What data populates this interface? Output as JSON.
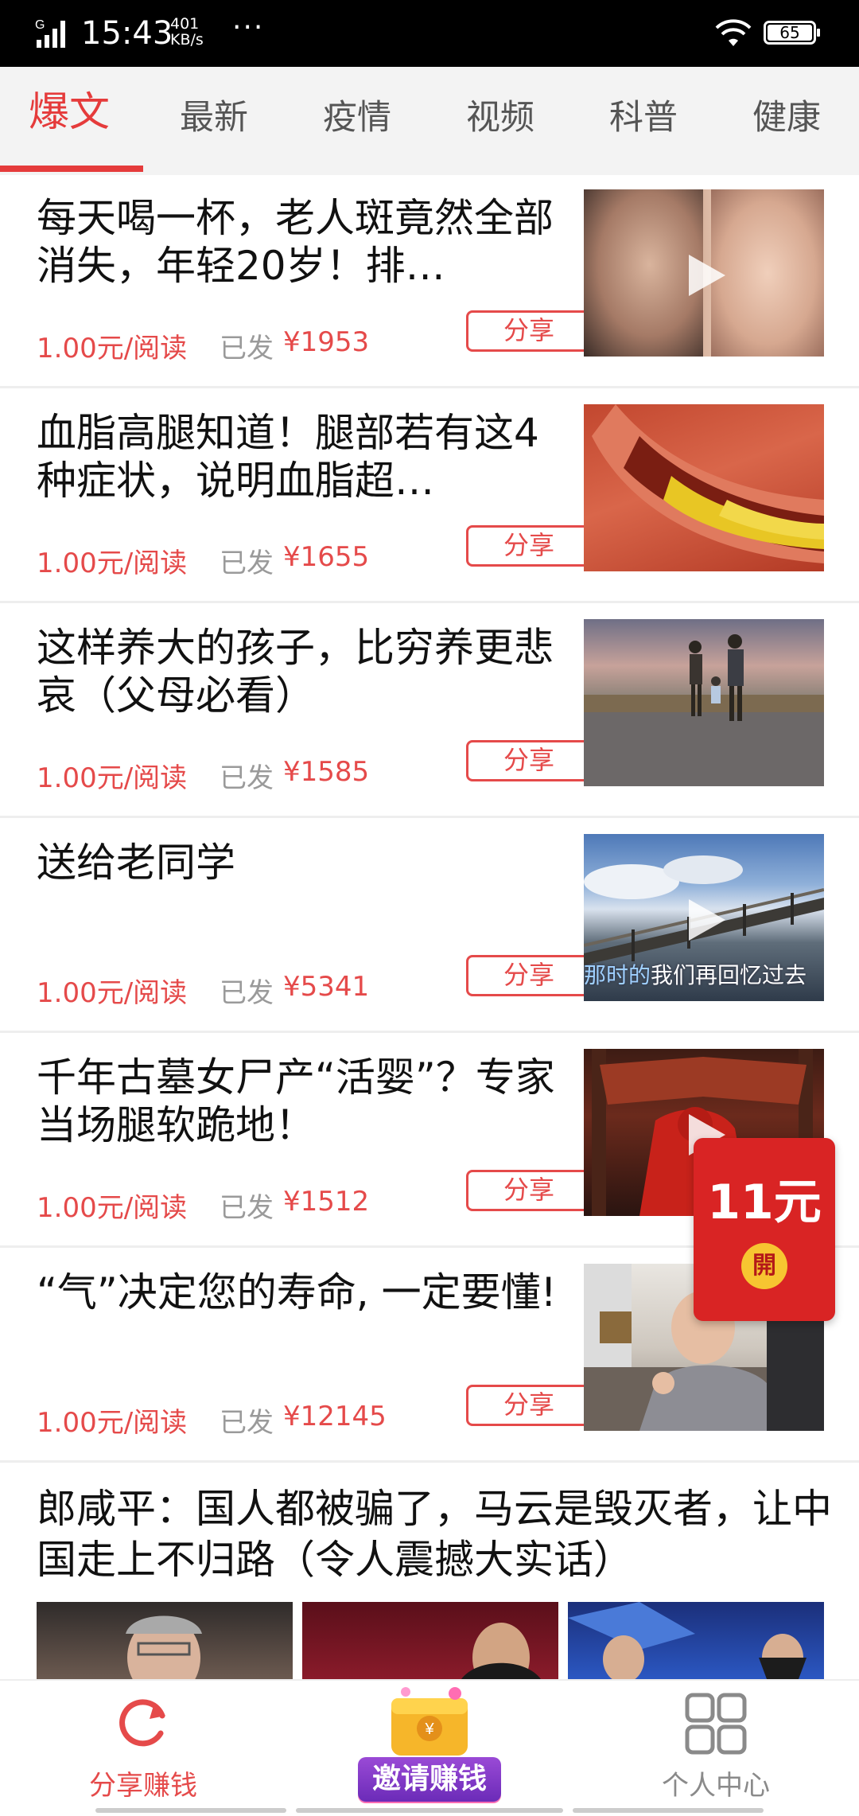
{
  "status_bar": {
    "network": "G",
    "time": "15:43",
    "speed_value": "401",
    "speed_unit": "KB/s",
    "more": "···",
    "battery": "65"
  },
  "tabs": [
    {
      "label": "爆文",
      "active": true
    },
    {
      "label": "最新",
      "active": false
    },
    {
      "label": "疫情",
      "active": false
    },
    {
      "label": "视频",
      "active": false
    },
    {
      "label": "科普",
      "active": false
    },
    {
      "label": "健康",
      "active": false
    }
  ],
  "articles": [
    {
      "title": "每天喝一杯，老人斑竟然全部消失，年轻20岁！排…",
      "price": "1.00元/阅读",
      "sent_label": "已发",
      "amount": "¥1953",
      "share": "分享",
      "thumb": "elderly-faces",
      "has_play": true
    },
    {
      "title": "血脂高腿知道！腿部若有这4种症状，说明血脂超…",
      "price": "1.00元/阅读",
      "sent_label": "已发",
      "amount": "¥1655",
      "share": "分享",
      "thumb": "blood-vessel",
      "has_play": false
    },
    {
      "title": "这样养大的孩子，比穷养更悲哀（父母必看）",
      "price": "1.00元/阅读",
      "sent_label": "已发",
      "amount": "¥1585",
      "share": "分享",
      "thumb": "family-walk",
      "has_play": false
    },
    {
      "title": "送给老同学",
      "price": "1.00元/阅读",
      "sent_label": "已发",
      "amount": "¥5341",
      "share": "分享",
      "thumb": "bridge-sky",
      "has_play": true,
      "caption_highlight": "那时的",
      "caption_rest": "我们再回忆过去"
    },
    {
      "title": "千年古墓女尸产“活婴”？专家当场腿软跪地！",
      "price": "1.00元/阅读",
      "sent_label": "已发",
      "amount": "¥1512",
      "share": "分享",
      "thumb": "red-bride",
      "has_play": true
    },
    {
      "title": "“气”决定您的寿命, 一定要懂!",
      "price": "1.00元/阅读",
      "sent_label": "已发",
      "amount": "¥12145",
      "share": "分享",
      "thumb": "old-man-office",
      "has_play": false
    }
  ],
  "big_article": {
    "title": "郎咸平：国人都被骗了，马云是毁灭者，让中国走上不归路（令人震撼大实话）"
  },
  "red_packet": {
    "amount": "11元",
    "open_label": "開"
  },
  "bottom_nav": {
    "share_earn": "分享赚钱",
    "invite_earn": "邀请赚钱",
    "profile": "个人中心"
  },
  "colors": {
    "accent": "#e54a4a",
    "tab_active": "#e53b3b",
    "red_packet": "#d92424",
    "invite": "#7a34c4"
  }
}
